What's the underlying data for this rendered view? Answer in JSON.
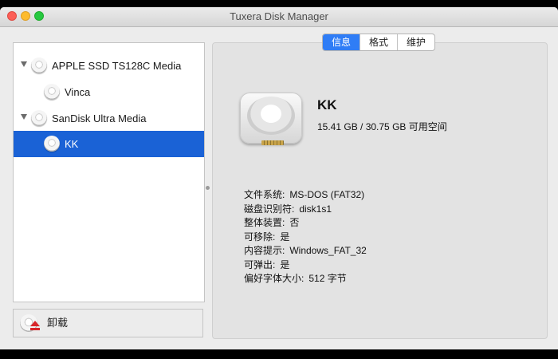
{
  "window": {
    "title": "Tuxera Disk Manager"
  },
  "sidebar": {
    "items": [
      {
        "label": "APPLE SSD TS128C Media",
        "level": 0,
        "expanded": true,
        "selected": false
      },
      {
        "label": "Vinca",
        "level": 1,
        "selected": false
      },
      {
        "label": "SanDisk Ultra Media",
        "level": 0,
        "expanded": true,
        "selected": false
      },
      {
        "label": "KK",
        "level": 1,
        "selected": true
      }
    ],
    "footer": {
      "eject_label": "卸载"
    }
  },
  "tabs": [
    {
      "label": "信息",
      "active": true
    },
    {
      "label": "格式",
      "active": false
    },
    {
      "label": "维护",
      "active": false
    }
  ],
  "volume": {
    "name": "KK",
    "space": "15.41 GB / 30.75 GB 可用空间"
  },
  "info": [
    {
      "key": "文件系统:",
      "value": "MS-DOS (FAT32)"
    },
    {
      "key": "磁盘识别符:",
      "value": "disk1s1"
    },
    {
      "key": "整体装置:",
      "value": "否"
    },
    {
      "key": "可移除:",
      "value": "是"
    },
    {
      "key": "内容提示:",
      "value": "Windows_FAT_32"
    },
    {
      "key": "可弹出:",
      "value": "是"
    },
    {
      "key": "偏好字体大小:",
      "value": "512 字节"
    }
  ],
  "colors": {
    "selection": "#1a62d6",
    "tab_active": "#2f7df6",
    "eject_red": "#d8262b"
  }
}
